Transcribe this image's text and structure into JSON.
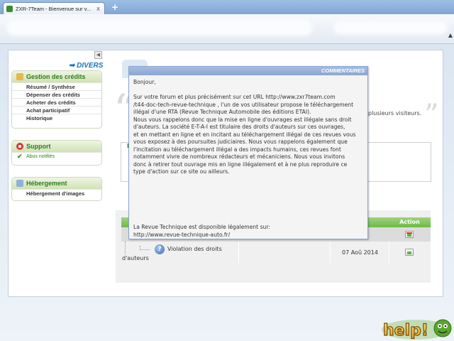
{
  "browser": {
    "tab_title": "ZXR-7Team - Bienvenue sur v...",
    "tab_close": "x",
    "new_tab": "+"
  },
  "sidebar": {
    "collapse_glyph": "◀",
    "divers_label": "DIVERS",
    "credits": {
      "title": "Gestion des crédits",
      "items": [
        "Résumé / Synthèse",
        "Dépenser des crédits",
        "Acheter des crédits",
        "Achat participatif",
        "Historique"
      ]
    },
    "support": {
      "title": "Support",
      "items": [
        "Abus notifiés"
      ]
    },
    "hosting": {
      "title": "Hébergement",
      "items": [
        "Hébergement d'images"
      ]
    }
  },
  "main": {
    "bg_text_fragment": "plusieurs visiteurs.",
    "action_header": "Action",
    "topic": {
      "title": "Violation des droits",
      "continuation": "d'auteurs",
      "date": "07 Aoû 2014"
    }
  },
  "modal": {
    "header": "COMMENTAIRES",
    "body": "Bonjour,\n\nSur votre forum et plus précisément sur cet URL http://www.zxr7team.com\n/t44-doc-tech-revue-technique , l'un de vos utilisateur propose le téléchargement\nillégal d'une RTA (Revue Technique Automobile des éditions ETAI).\nNous vous rappelons donc que la mise en ligne d'ouvrages est illégale sans droit\nd'auteurs. La société E-T-A-I est titulaire des droits d'auteurs sur ces ouvrages,\net en mettant en ligne et en incitant au téléchargement illégal de ces revues vous\nvous exposez à des poursuites judiciaires. Nous vous rappelons également que\nl'incitation au téléchargement illégal a des impacts humains, ces revues font\nnotamment vivre de nombreux rédacteurs et mécaniciens. Nous vous invitons\ndonc à retirer tout ouvrage mis en ligne illégalement et à ne plus reproduire ce\ntype d'action sur ce site ou ailleurs.",
    "footer_line1": "La Revue Technique est disponible légalement sur:",
    "footer_line2": "http://www.revue-technique-auto.fr/"
  },
  "badge": {
    "text": "help!"
  },
  "colors": {
    "green_accent": "#2d7d1a",
    "blue_accent": "#1b73b8",
    "modal_header": "#8ba6d2",
    "table_header": "#6dbb44"
  }
}
